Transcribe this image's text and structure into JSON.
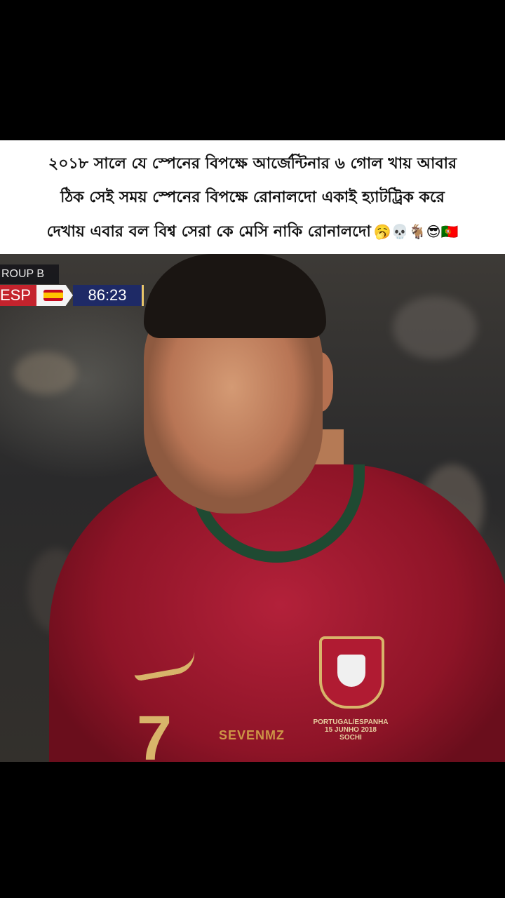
{
  "caption": {
    "lines": [
      "২০১৮ সালে যে স্পেনের বিপক্ষে আর্জেন্টিনার ৬ গোল খায় আবার",
      "ঠিক সেই সময় স্পেনের বিপক্ষে রোনালদো একাই হ্যাটট্রিক করে",
      "দেখায় এবার বল বিশ্ব সেরা কে মেসি নাকি রোনালদো"
    ],
    "emojis": "🥱💀🐐😎🇵🇹"
  },
  "scorebug": {
    "group": "ROUP B",
    "team": "ESP",
    "clock": "86:23"
  },
  "jersey": {
    "number": "7",
    "watermark": "SEVENMZ",
    "match_line1": "PORTUGAL/ESPANHA",
    "match_line2": "15 JUNHO 2018",
    "match_line3": "SOCHI"
  },
  "colors": {
    "caption_bg": "#ffffff",
    "jersey_red": "#b3213a",
    "collar_green": "#1f4a32",
    "gold": "#d8b46a",
    "clock_blue": "#1e2a66",
    "spain_red": "#c4232d"
  }
}
